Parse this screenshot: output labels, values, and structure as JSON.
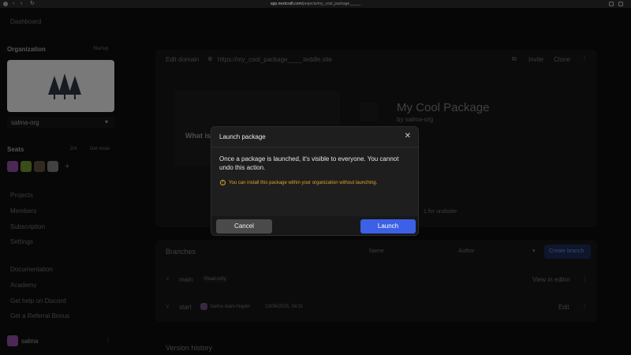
{
  "browser": {
    "url_domain": "app.nextcraft.com",
    "url_path": "/projects/my_cool_package_____"
  },
  "sidebar": {
    "dashboard": "Dashboard",
    "organization_label": "Organization",
    "organization_plan": "Startup",
    "org_name": "salma-org",
    "seats_label": "Seats",
    "seats_count": "2/4",
    "get_more": "Get more",
    "nav_items": [
      "Projects",
      "Members",
      "Subscription",
      "Settings"
    ],
    "help_items": [
      "Documentation",
      "Academy",
      "Get help on Discord",
      "Get a Referral Bonus"
    ],
    "user_name": "salma"
  },
  "main": {
    "edit_domain": "Edit domain",
    "domain": "https://my_cool_package____.teddle.site",
    "invite": "Invite",
    "clone": "Clone",
    "package_title": "My Cool Package",
    "package_owner": "by salma-org",
    "preview_heading": "What is l",
    "side_note": "1 for undistier",
    "branches_title": "Branches",
    "filter_name": "Name",
    "filter_author": "Author",
    "create_branch": "Create branch",
    "branch_rows": [
      {
        "name": "main",
        "badge": "Read-only",
        "action": "View in editor",
        "author": "",
        "date": ""
      },
      {
        "name": "start",
        "badge": "",
        "action": "Edit",
        "author": "Salma Alam-Naylor",
        "date": "13/06/2025, 08:31"
      }
    ],
    "version_history": "Version history"
  },
  "modal": {
    "title": "Launch package",
    "body": "Once a package is launched, it's visible to everyone. You cannot undo this action.",
    "warning": "You can install this package within your organization without launching.",
    "cancel": "Cancel",
    "launch": "Launch"
  },
  "colors": {
    "primary": "#3c61e6",
    "warning": "#e0a328",
    "modal_bg": "#1e1e1e",
    "page_bg": "#0b0b0b"
  }
}
